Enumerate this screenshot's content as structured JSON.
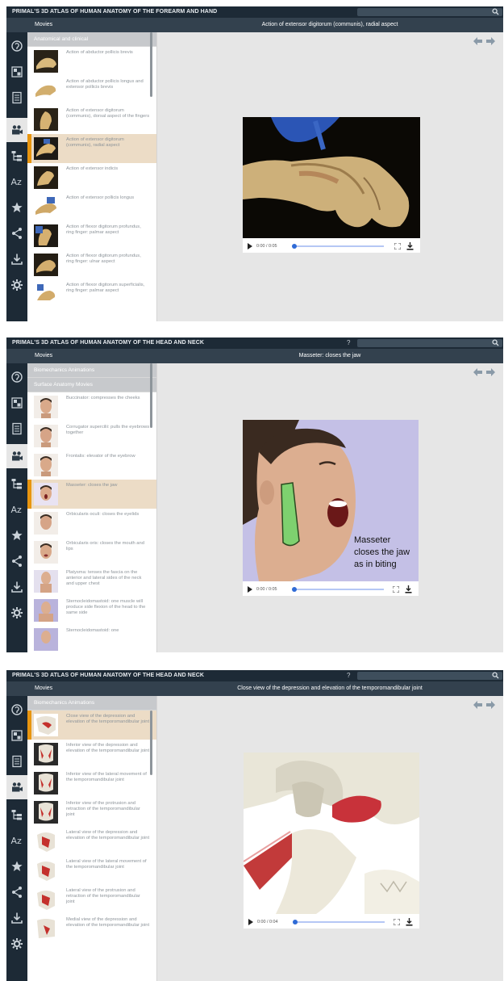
{
  "help_label": "?",
  "colors": {
    "topbar": "#1d2a36",
    "subbar": "#33414e",
    "selected_row": "#ecdcc6",
    "accent": "#e8950f",
    "progress": "#2f6bd6"
  },
  "icons": {
    "rail": [
      "ear-icon",
      "diagram-icon",
      "book-icon",
      "video-camera-icon",
      "tree-icon",
      "az-icon",
      "star-icon",
      "share-icon",
      "download-icon",
      "gear-icon"
    ]
  },
  "screens": [
    {
      "app_title": "PRIMAL'S 3D ATLAS OF HUMAN ANATOMY OF THE FOREARM AND HAND",
      "section": "Movies",
      "video_title": "Action of extensor digitorum (communis), radial aspect",
      "categories": [
        "Anatomical and clinical"
      ],
      "items": [
        "Action of abductor pollicis brevis",
        "Action of abductor pollicis longus and extensor pollicis brevis",
        "Action of extensor digitorum (communis), dorsal aspect of the fingers",
        "Action of extensor digitorum (communis), radial aspect",
        "Action of extensor indicis",
        "Action of extensor pollicis longus",
        "Action of flexor digitorum profundus, ring finger: palmar aspect",
        "Action of flexor digitorum profundus, ring finger: ulnar aspect",
        "Action of flexor digitorum superficialis, ring finger: palmar aspect"
      ],
      "selected_index": 3,
      "time": "0:00 / 0:05"
    },
    {
      "app_title": "PRIMAL'S 3D ATLAS OF HUMAN ANATOMY OF THE HEAD AND NECK",
      "section": "Movies",
      "video_title": "Masseter: closes the jaw",
      "categories": [
        "Biomechanics Animations",
        "Surface Anatomy Movies"
      ],
      "items": [
        "Buccinator: compresses the cheeks",
        "Corrugator supercilii: pulls the eyebrows together",
        "Frontalis: elevator of the eyebrow",
        "Masseter: closes the jaw",
        "Orbicularis oculi: closes the eyelids",
        "Orbicularis oris: closes the mouth and lips",
        "Platysma: tenses the fascia on the anterior and lateral sides of the neck and upper chest",
        "Sternocleidomastoid: one muscle will produce side flexion of the head to the same side",
        "Sternocleidomastoid: one"
      ],
      "selected_index": 3,
      "caption": [
        "Masseter",
        "closes the jaw",
        "as in biting"
      ],
      "time": "0:00 / 0:05"
    },
    {
      "app_title": "PRIMAL'S 3D ATLAS OF HUMAN ANATOMY OF THE HEAD AND NECK",
      "section": "Movies",
      "video_title": "Close view of the depression and elevation of the temporomandibular joint",
      "categories": [
        "Biomechanics Animations"
      ],
      "items": [
        "Close view of the depression and elevation of the temporomandibular joint",
        "Inferior view of the depression and elevation of the temporomandibular joint",
        "Inferior view of the lateral movement of the temporomandibular joint",
        "Inferior view of the protrusion and retraction of the temporomandibular joint",
        "Lateral view of the depression and elevation of the temporomandibular joint",
        "Lateral view of the lateral movement of the temporomandibular joint",
        "Lateral view of the protrusion and retraction of the temporomandibular joint",
        "Medial view of the depression and elevation of the temporomandibular joint"
      ],
      "selected_index": 0,
      "time": "0:00 / 0:04"
    }
  ]
}
